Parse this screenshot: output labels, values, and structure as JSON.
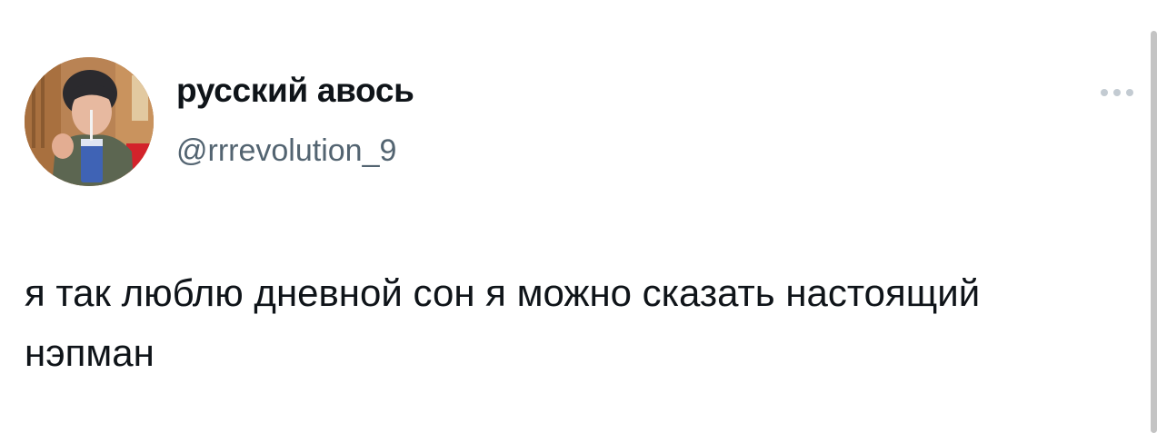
{
  "author": {
    "display_name": "русский авось",
    "handle": "@rrrevolution_9"
  },
  "tweet": {
    "text": "я так люблю дневной сон я можно сказать настоящий нэпман"
  },
  "icons": {
    "more": "more-horizontal-icon",
    "avatar": "profile-photo"
  }
}
